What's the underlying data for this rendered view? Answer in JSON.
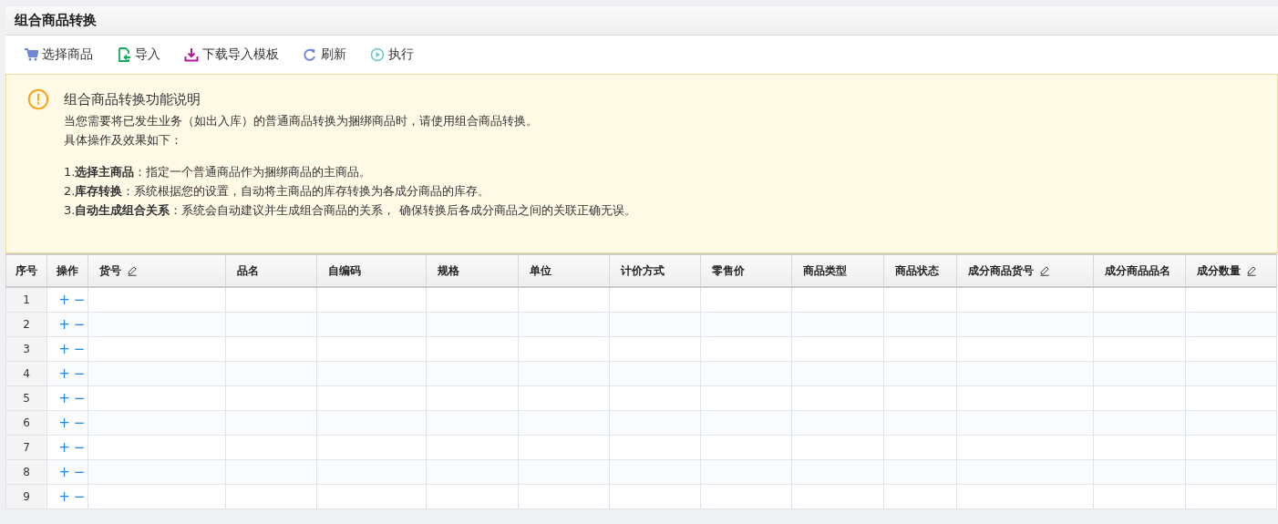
{
  "page": {
    "title": "组合商品转换"
  },
  "toolbar": [
    {
      "kind": "cart",
      "label": "选择商品"
    },
    {
      "kind": "import",
      "label": "导入"
    },
    {
      "kind": "download",
      "label": "下载导入模板"
    },
    {
      "kind": "refresh",
      "label": "刷新"
    },
    {
      "kind": "run",
      "label": "执行"
    }
  ],
  "notice": {
    "title": "组合商品转换功能说明",
    "intro": [
      "当您需要将已发生业务（如出入库）的普通商品转换为捆绑商品时，请使用组合商品转换。",
      "具体操作及效果如下："
    ],
    "steps": [
      "1.**选择主商品**：指定一个普通商品作为捆绑商品的主商品。",
      "2.**库存转换**：系统根据您的设置，自动将主商品的库存转换为各成分商品的库存。",
      "3.**自动生成组合关系**：系统会自动建议并生成组合商品的关系， 确保转换后各成分商品之间的关联正确无误。"
    ]
  },
  "table": {
    "columns": [
      {
        "label": "序号",
        "editable": false
      },
      {
        "label": "操作",
        "editable": false
      },
      {
        "label": "货号",
        "editable": true
      },
      {
        "label": "品名",
        "editable": false
      },
      {
        "label": "自编码",
        "editable": false
      },
      {
        "label": "规格",
        "editable": false
      },
      {
        "label": "单位",
        "editable": false
      },
      {
        "label": "计价方式",
        "editable": false
      },
      {
        "label": "零售价",
        "editable": false
      },
      {
        "label": "商品类型",
        "editable": false
      },
      {
        "label": "商品状态",
        "editable": false
      },
      {
        "label": "成分商品货号",
        "editable": true
      },
      {
        "label": "成分商品品名",
        "editable": false
      },
      {
        "label": "成分数量",
        "editable": true
      }
    ],
    "rows": [
      {
        "number": "1",
        "add": "+",
        "remove": "−"
      },
      {
        "number": "2",
        "add": "+",
        "remove": "−"
      },
      {
        "number": "3",
        "add": "+",
        "remove": "−"
      },
      {
        "number": "4",
        "add": "+",
        "remove": "−"
      },
      {
        "number": "5",
        "add": "+",
        "remove": "−"
      },
      {
        "number": "6",
        "add": "+",
        "remove": "−"
      },
      {
        "number": "7",
        "add": "+",
        "remove": "−"
      },
      {
        "number": "8",
        "add": "+",
        "remove": "−"
      },
      {
        "number": "9",
        "add": "+",
        "remove": "−"
      }
    ]
  }
}
